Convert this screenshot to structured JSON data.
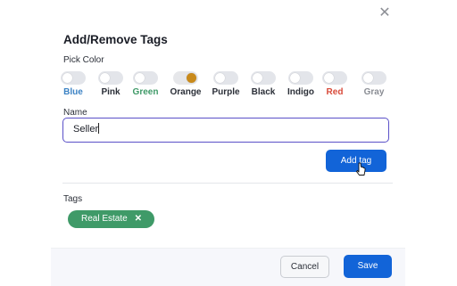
{
  "modal": {
    "title": "Add/Remove Tags",
    "close_icon": "close-icon"
  },
  "color_picker": {
    "label": "Pick Color",
    "options": [
      {
        "label": "Blue",
        "color": "#3b82c4",
        "selected": false
      },
      {
        "label": "Pink",
        "color": "#2b2f38",
        "selected": false
      },
      {
        "label": "Green",
        "color": "#3f9a68",
        "selected": false
      },
      {
        "label": "Orange",
        "color": "#2b2f38",
        "selected": true,
        "knob_color": "#c98a1b"
      },
      {
        "label": "Purple",
        "color": "#2b2f38",
        "selected": false
      },
      {
        "label": "Black",
        "color": "#2b2f38",
        "selected": false
      },
      {
        "label": "Indigo",
        "color": "#2b2f38",
        "selected": false
      },
      {
        "label": "Red",
        "color": "#d84a3a",
        "selected": false
      },
      {
        "label": "Gray",
        "color": "#8a8d94",
        "selected": false
      }
    ]
  },
  "name_field": {
    "label": "Name",
    "value": "Seller"
  },
  "add_button": {
    "label": "Add tag"
  },
  "tags": {
    "label": "Tags",
    "items": [
      {
        "label": "Real Estate",
        "remove_icon": "x-icon",
        "color": "#3f9a68"
      }
    ]
  },
  "footer": {
    "cancel_label": "Cancel",
    "save_label": "Save"
  }
}
